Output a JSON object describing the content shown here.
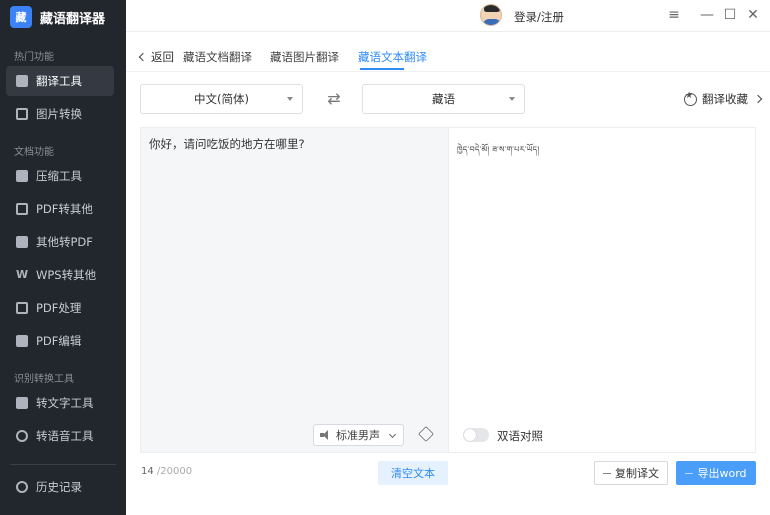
{
  "app": {
    "logo_text": "藏",
    "name": "藏语翻译器"
  },
  "sidebar": {
    "sections": [
      {
        "label": "热门功能"
      },
      {
        "label": "文档功能"
      },
      {
        "label": "识别转换工具"
      }
    ],
    "items": [
      {
        "label": "翻译工具",
        "icon": "translate-icon",
        "active": true
      },
      {
        "label": "图片转换",
        "icon": "image-convert-icon"
      },
      {
        "label": "压缩工具",
        "icon": "compress-icon"
      },
      {
        "label": "PDF转其他",
        "icon": "pdf-icon"
      },
      {
        "label": "其他转PDF",
        "icon": "to-pdf-icon"
      },
      {
        "label": "WPS转其他",
        "icon": "wps-icon"
      },
      {
        "label": "PDF处理",
        "icon": "pdf-process-icon"
      },
      {
        "label": "PDF编辑",
        "icon": "pdf-edit-icon"
      },
      {
        "label": "转文字工具",
        "icon": "text-convert-icon"
      },
      {
        "label": "转语音工具",
        "icon": "voice-convert-icon"
      },
      {
        "label": "历史记录",
        "icon": "history-icon"
      }
    ]
  },
  "titlebar": {
    "login": "登录/注册",
    "menu": "≡",
    "minimize": "—",
    "maximize": "☐",
    "close": "✕"
  },
  "tabs": {
    "back": "返回",
    "items": [
      {
        "label": "藏语文档翻译"
      },
      {
        "label": "藏语图片翻译"
      },
      {
        "label": "藏语文本翻译",
        "active": true
      }
    ]
  },
  "languages": {
    "source": "中文(简体)",
    "target": "藏语",
    "swap": "⇄"
  },
  "favorites": "翻译收藏",
  "source_panel": {
    "text": "你好，请问吃饭的地方在哪里?",
    "voice": "标准男声"
  },
  "target_panel": {
    "text": "ཁྱེད་བདེ་མོ། ཟ་ས་ག་པར་ཡོད།",
    "bilingual_label": "双语对照"
  },
  "bottom": {
    "count": "14",
    "max": " /20000",
    "clear": "清空文本",
    "copy": "复制译文",
    "export": "导出word"
  },
  "colors": {
    "sidebar_bg": "#22262d",
    "accent": "#2f8cf6",
    "export_bg": "#4a9df8"
  }
}
